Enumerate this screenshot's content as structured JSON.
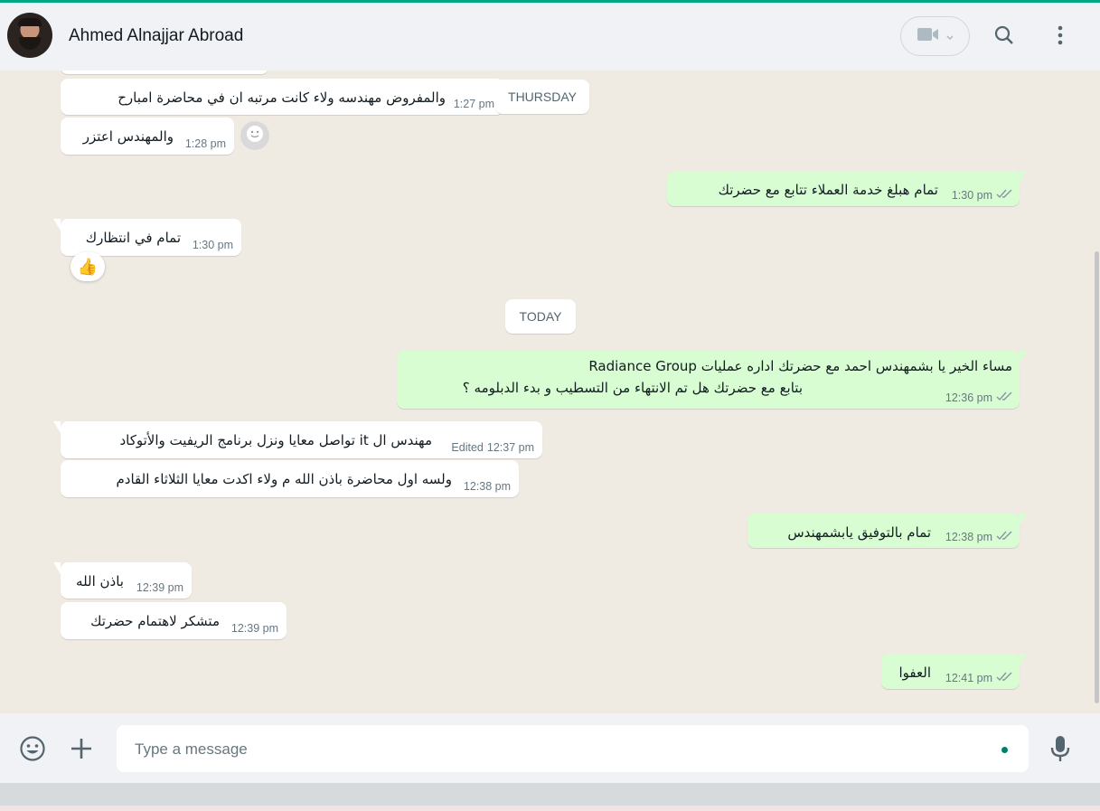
{
  "header": {
    "contact_name": "Ahmed Alnajjar Abroad",
    "icons": [
      "video-call-icon",
      "search-icon",
      "menu-icon"
    ]
  },
  "colors": {
    "accent": "#00a884",
    "incoming": "#ffffff",
    "outgoing": "#d9fdd3",
    "background": "#efeae2"
  },
  "dates": {
    "thursday": "THURSDAY",
    "today": "TODAY"
  },
  "messages": [
    {
      "dir": "in",
      "text": "والمفروض مهندسه ولاء كانت مرتبه ان في محاضرة امبارح",
      "time": "1:27 pm"
    },
    {
      "dir": "in",
      "text": "والمهندس اعتزر",
      "time": "1:28 pm"
    },
    {
      "dir": "out",
      "text": "تمام هبلغ خدمة العملاء تتابع مع حضرتك",
      "time": "1:30 pm"
    },
    {
      "dir": "in",
      "text": "تمام في انتظارك",
      "time": "1:30 pm",
      "reaction": "👍"
    },
    {
      "dir": "out",
      "line1": "مساء الخير يا بشمهندس احمد مع  حضرتك اداره عمليات Radiance Group",
      "line2": "بتابع مع حضرتك هل تم الانتهاء من التسطيب و بدء الدبلومه ؟",
      "time": "12:36 pm"
    },
    {
      "dir": "in",
      "text": "مهندس ال it تواصل معايا ونزل برنامج الريفيت والأتوكاد",
      "edited": "Edited",
      "time": "12:37 pm"
    },
    {
      "dir": "in",
      "text": "ولسه اول محاضرة باذن الله م ولاء اكدت معايا الثلاثاء القادم",
      "time": "12:38 pm"
    },
    {
      "dir": "out",
      "text": "تمام  بالتوفيق يابشمهندس",
      "time": "12:38 pm"
    },
    {
      "dir": "in",
      "text": "باذن الله",
      "time": "12:39 pm"
    },
    {
      "dir": "in",
      "text": "متشكر لاهتمام حضرتك",
      "time": "12:39 pm"
    },
    {
      "dir": "out",
      "text": "العفوا",
      "time": "12:41 pm"
    }
  ],
  "composer": {
    "placeholder": "Type a message"
  }
}
